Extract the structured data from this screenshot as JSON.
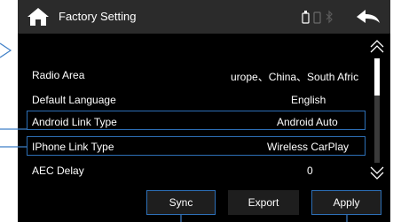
{
  "header": {
    "title": "Factory Setting",
    "home_icon": "home-icon",
    "back_icon": "back-arrow-icon",
    "status_icons": [
      "usb-icon",
      "phone-icon",
      "bluetooth-icon"
    ]
  },
  "settings": [
    {
      "label": "Radio Area",
      "value": "urope、China、South Afric"
    },
    {
      "label": "Default Language",
      "value": "English"
    },
    {
      "label": "Android Link Type",
      "value": "Android Auto"
    },
    {
      "label": "IPhone Link Type",
      "value": "Wireless CarPlay"
    },
    {
      "label": "AEC Delay",
      "value": "0"
    }
  ],
  "buttons": {
    "sync": "Sync",
    "export": "Export",
    "apply": "Apply"
  },
  "colors": {
    "accent": "#2d6fb6",
    "background": "#000000",
    "titlebar": "#2b2b2b"
  }
}
